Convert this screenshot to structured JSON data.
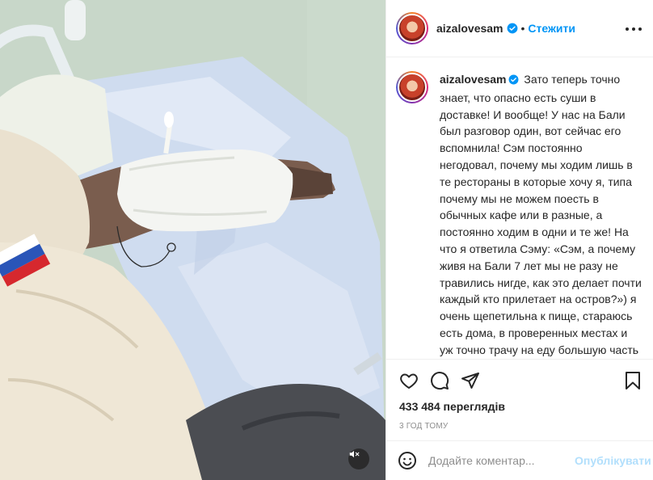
{
  "post": {
    "username": "aizalovesam",
    "follow_label": "Стежити",
    "separator": "•"
  },
  "caption": {
    "username": "aizalovesam",
    "text": "Зато теперь точно знает, что опасно есть суши в доставке! И вообще! У нас на Бали был разговор один, вот сейчас его вспомнила! Сэм постоянно негодовал, почему мы ходим лишь в те рестораны в которые хочу я, типа почему мы не можем поесть в обычных кафе или в разные, а постоянно ходим в одни и те же! На что я ответила Сэму: «Сэм, а почему живя на Бали 7 лет мы не разу не травились нигде, как это делает почти каждый кто прилетает на остров?») я очень щепетильна к пище, стараюсь есть дома, в проверенных местах и уж точно трачу на еду большую часть своего заработка! Потому что боюсь вот такого😩"
  },
  "stats": {
    "views": "433 484 переглядів",
    "time": "3 год тому"
  },
  "comment": {
    "placeholder": "Додайте коментар...",
    "post_label": "Опублікувати"
  },
  "icons": {
    "verified": "verified-badge-icon",
    "more": "more-options-icon",
    "like": "heart-icon",
    "comment": "comment-icon",
    "share": "send-icon",
    "save": "bookmark-icon",
    "emoji": "emoji-icon",
    "mute": "muted-speaker-icon"
  },
  "colors": {
    "accent": "#0095f6",
    "post_disabled": "#b2dffc",
    "text": "#262626",
    "secondary": "#8e8e8e"
  }
}
